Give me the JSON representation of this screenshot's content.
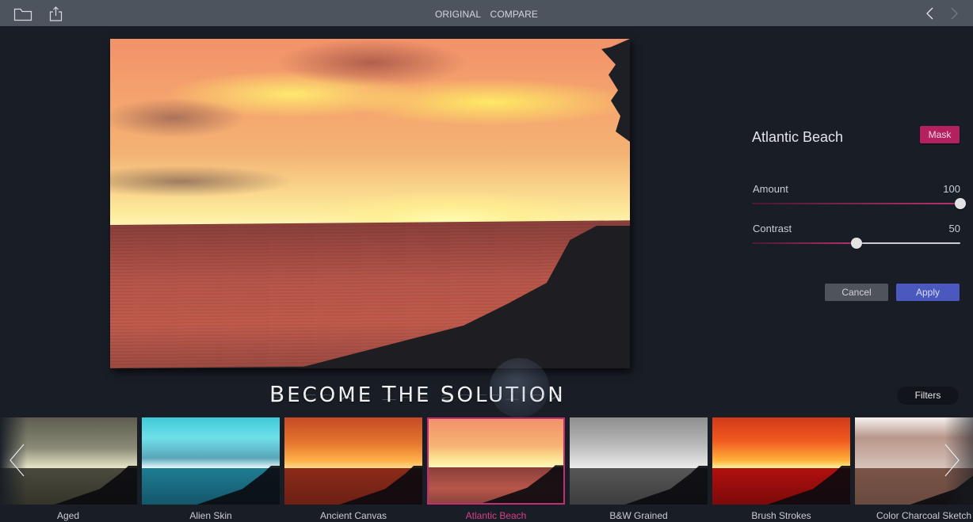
{
  "toolbar": {
    "left_icons": [
      "folder-icon",
      "share-icon"
    ],
    "view_modes": [
      "ORIGINAL",
      "COMPARE"
    ],
    "nav": [
      "chevron-left-icon",
      "chevron-right-icon"
    ]
  },
  "preview": {
    "description": "Sunset over ocean with Atlantic Beach filter applied"
  },
  "panel": {
    "filter_name": "Atlantic Beach",
    "mask_label": "Mask",
    "sliders": [
      {
        "label": "Amount",
        "value": "100",
        "fraction": 1.0
      },
      {
        "label": "Contrast",
        "value": "50",
        "fraction": 0.5
      }
    ],
    "cancel_label": "Cancel",
    "apply_label": "Apply"
  },
  "filters_label": "Filters",
  "watermark": {
    "text": "Become The Solution"
  },
  "strip": {
    "selected_index": 3,
    "items": [
      {
        "label": "Aged",
        "sky": "linear-gradient(180deg,#5d5c4f,#8a8a76 60%,#e9e6c8 100%)",
        "sea": "linear-gradient(180deg,#4b4a3e,#35342a)"
      },
      {
        "label": "Alien Skin",
        "sky": "linear-gradient(180deg,#3fc9d8,#6fe0ea 40%,#5aa6b8 80%,#e9fbff 100%)",
        "sea": "linear-gradient(180deg,#1f7d93,#14566a)"
      },
      {
        "label": "Ancient Canvas",
        "sky": "linear-gradient(180deg,#c44a26,#e5762e 50%,#ffb04a 85%,#ffd98a 100%)",
        "sea": "linear-gradient(180deg,#8c2a1a,#6c2013)"
      },
      {
        "label": "Atlantic Beach",
        "sky": "linear-gradient(180deg,#f2926a,#f6b373 55%,#fde898 85%,#fff7b8 100%)",
        "sea": "linear-gradient(180deg,#8a3f3b,#b8564a 60%,#8c443d)"
      },
      {
        "label": "B&W Grained",
        "sky": "linear-gradient(180deg,#8f8f8f,#b5b5b5 50%,#ececec 100%)",
        "sea": "linear-gradient(180deg,#575757,#3d3d3d)"
      },
      {
        "label": "Brush Strokes",
        "sky": "linear-gradient(180deg,#d03a1a,#f0581f 45%,#ffb23a 85%,#fff3a0 100%)",
        "sea": "linear-gradient(180deg,#b0100e,#7c0a0a)"
      },
      {
        "label": "Color Charcoal Sketch",
        "sky": "linear-gradient(180deg,#f5f1ee,#b8968a 40%,#d8c4bb 100%)",
        "sea": "linear-gradient(180deg,#7a5447,#6a4a3f)"
      }
    ]
  }
}
